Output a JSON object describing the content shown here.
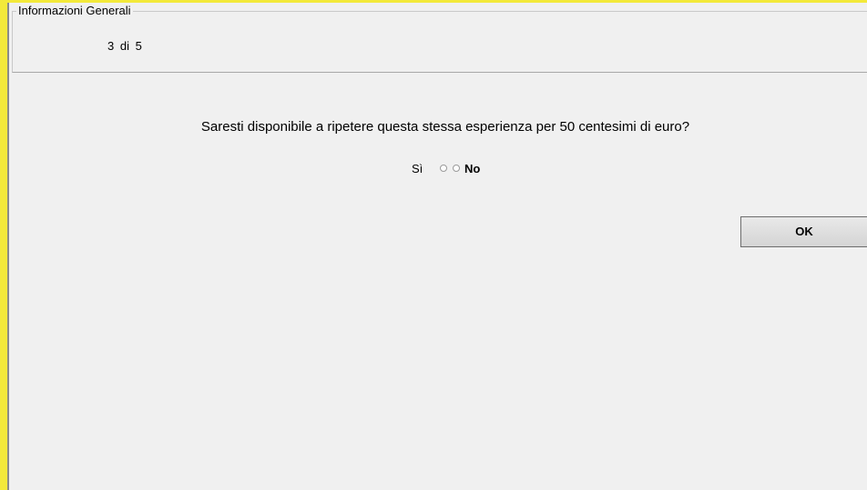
{
  "info_panel": {
    "legend": "Informazioni Generali",
    "progress": "3 di 5"
  },
  "question": {
    "text": "Saresti disponibile a ripetere questa stessa esperienza per 50 centesimi di euro?"
  },
  "answer": {
    "option_yes_label": "Sì",
    "option_no_label": "No"
  },
  "buttons": {
    "ok_label": "OK"
  },
  "colors": {
    "frame_accent": "#f3e93a",
    "background": "#f0f0f0"
  }
}
